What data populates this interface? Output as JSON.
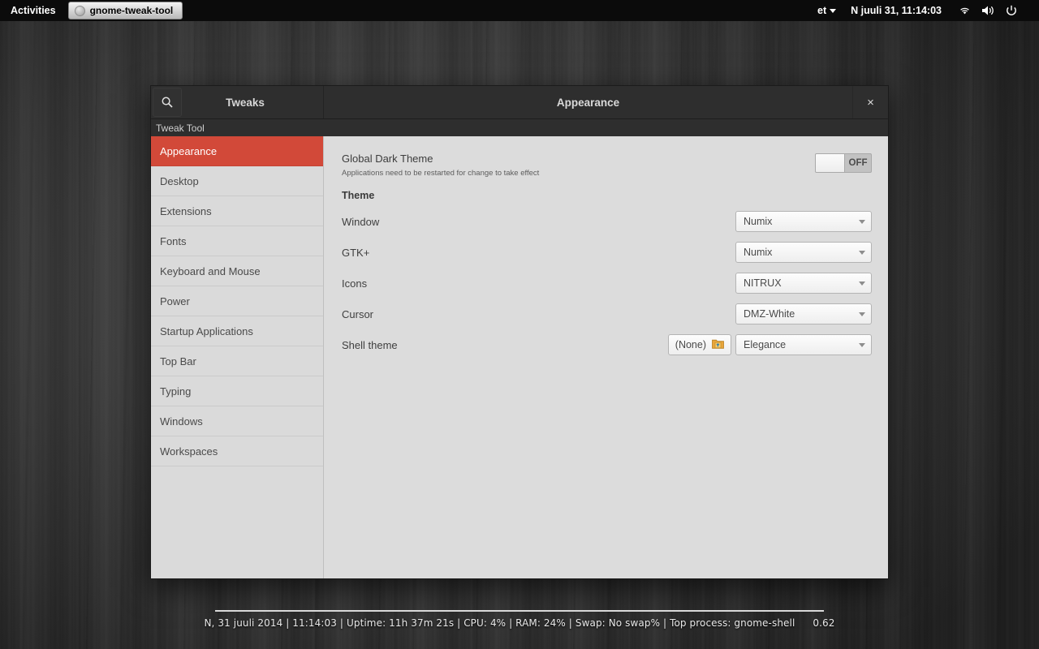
{
  "top_panel": {
    "activities": "Activities",
    "window_button": "gnome-tweak-tool",
    "keyboard_layout": "et",
    "clock": "N juuli 31, 11:14:03",
    "icons": [
      "wifi-icon",
      "volume-icon",
      "power-icon",
      "system-menu-caret"
    ]
  },
  "window": {
    "left_title": "Tweaks",
    "right_title": "Appearance",
    "subtitle": "Tweak Tool",
    "close_label": "×",
    "search_icon": "search-icon"
  },
  "sidebar": {
    "items": [
      {
        "label": "Appearance",
        "selected": true
      },
      {
        "label": "Desktop",
        "selected": false
      },
      {
        "label": "Extensions",
        "selected": false
      },
      {
        "label": "Fonts",
        "selected": false
      },
      {
        "label": "Keyboard and Mouse",
        "selected": false
      },
      {
        "label": "Power",
        "selected": false
      },
      {
        "label": "Startup Applications",
        "selected": false
      },
      {
        "label": "Top Bar",
        "selected": false
      },
      {
        "label": "Typing",
        "selected": false
      },
      {
        "label": "Windows",
        "selected": false
      },
      {
        "label": "Workspaces",
        "selected": false
      }
    ]
  },
  "content": {
    "global_dark_theme": {
      "label": "Global Dark Theme",
      "description": "Applications need to be restarted for change to take effect",
      "toggle_state": "OFF"
    },
    "section_title": "Theme",
    "options": [
      {
        "label": "Window",
        "value": "Numix"
      },
      {
        "label": "GTK+",
        "value": "Numix"
      },
      {
        "label": "Icons",
        "value": "NITRUX"
      },
      {
        "label": "Cursor",
        "value": "DMZ-White"
      },
      {
        "label": "Shell theme",
        "value": "Elegance",
        "file_button": "(None)"
      }
    ]
  },
  "conky": {
    "line": "N, 31 juuli 2014 | 11:14:03 | Uptime: 11h 37m 21s | CPU: 4% | RAM: 24% | Swap: No swap% | Top process: gnome-shell",
    "number": "0.62"
  },
  "colors": {
    "accent_red": "#D24939",
    "panel_bg": "#0B0B0B",
    "window_bg": "#DCDCDC",
    "headerbar_bg": "#2E2E2E"
  }
}
